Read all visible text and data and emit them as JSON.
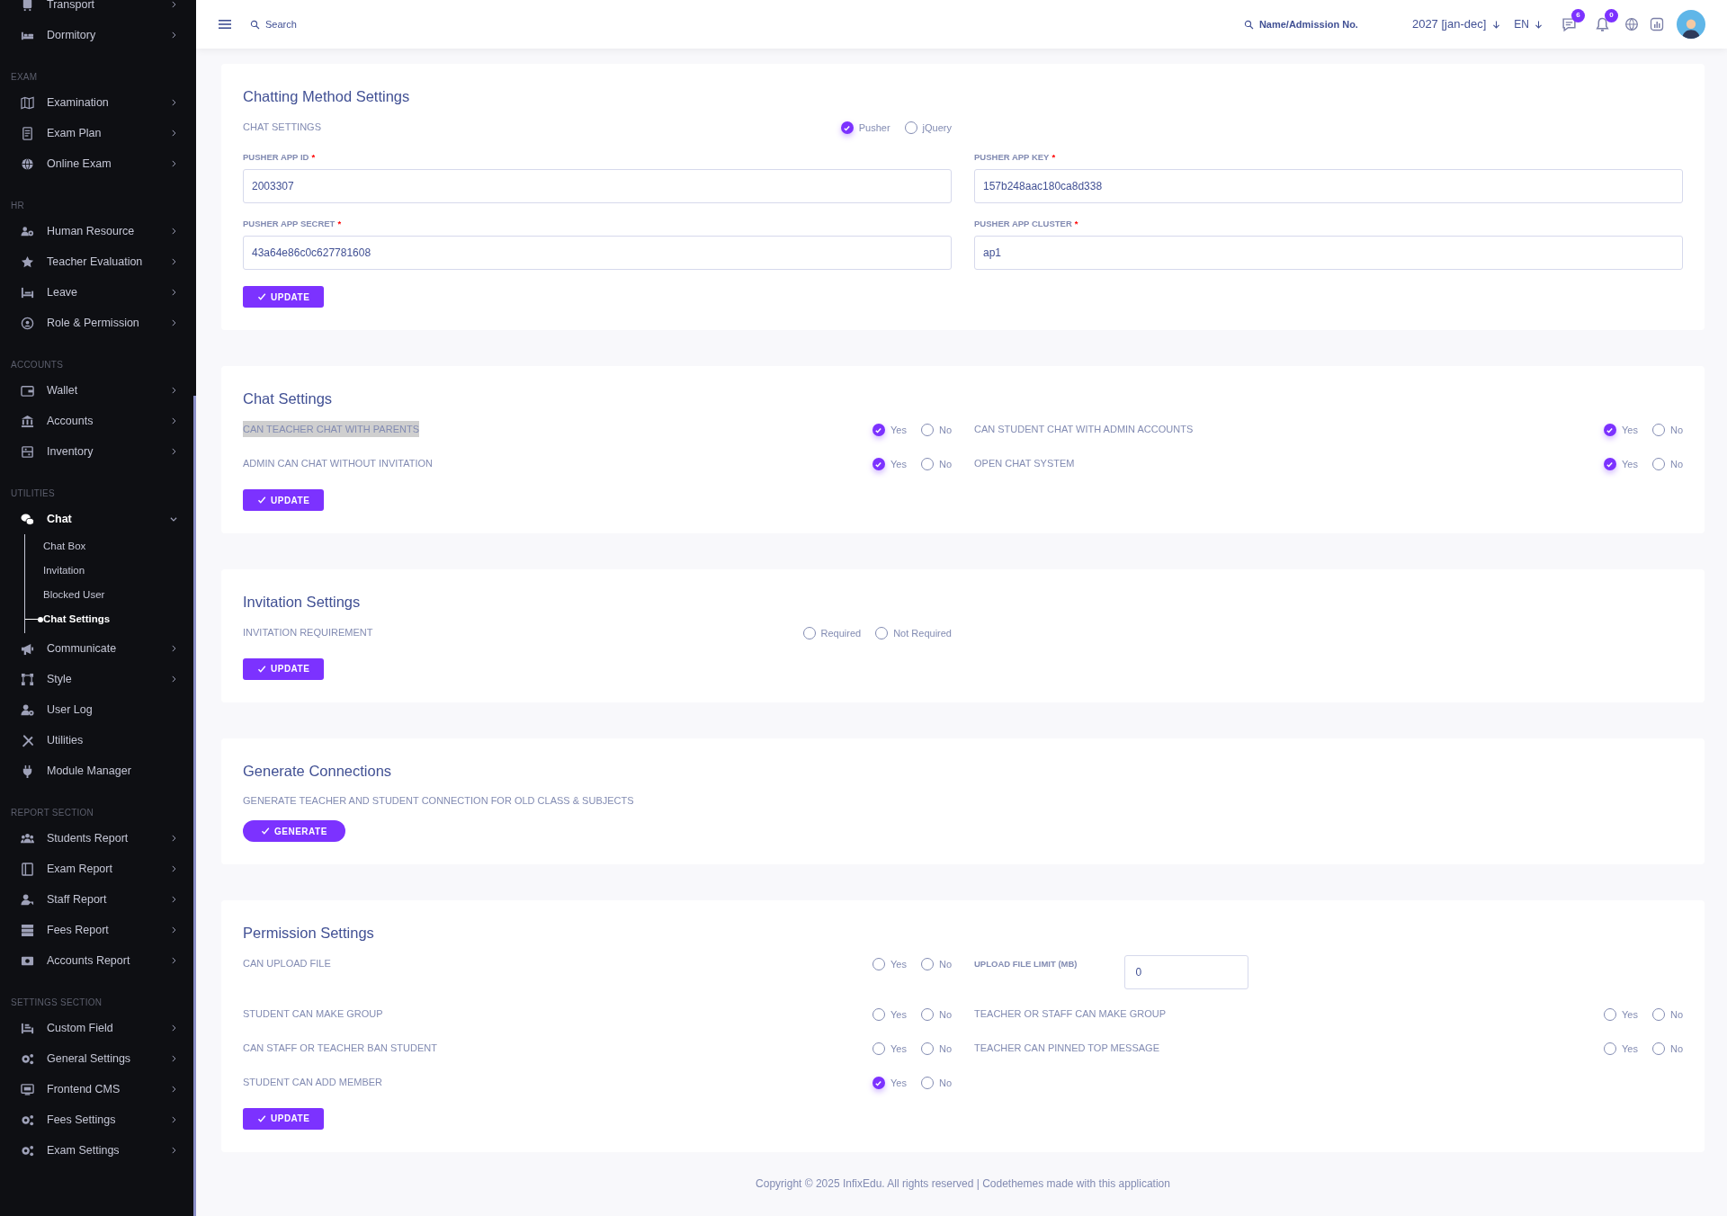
{
  "sidebar": {
    "items": [
      {
        "kind": "item",
        "label": "Transport",
        "expandable": true,
        "expanded": false
      },
      {
        "kind": "item",
        "label": "Dormitory",
        "expandable": true,
        "expanded": false
      },
      {
        "kind": "section",
        "label": "EXAM"
      },
      {
        "kind": "item",
        "label": "Examination",
        "expandable": true,
        "expanded": false
      },
      {
        "kind": "item",
        "label": "Exam Plan",
        "expandable": true,
        "expanded": false
      },
      {
        "kind": "item",
        "label": "Online Exam",
        "expandable": true,
        "expanded": false
      },
      {
        "kind": "section",
        "label": "HR"
      },
      {
        "kind": "item",
        "label": "Human Resource",
        "expandable": true,
        "expanded": false
      },
      {
        "kind": "item",
        "label": "Teacher Evaluation",
        "expandable": true,
        "expanded": false
      },
      {
        "kind": "item",
        "label": "Leave",
        "expandable": true,
        "expanded": false
      },
      {
        "kind": "item",
        "label": "Role & Permission",
        "expandable": true,
        "expanded": false
      },
      {
        "kind": "section",
        "label": "ACCOUNTS"
      },
      {
        "kind": "item",
        "label": "Wallet",
        "expandable": true,
        "expanded": false
      },
      {
        "kind": "item",
        "label": "Accounts",
        "expandable": true,
        "expanded": false
      },
      {
        "kind": "item",
        "label": "Inventory",
        "expandable": true,
        "expanded": false
      },
      {
        "kind": "section",
        "label": "UTILITIES"
      },
      {
        "kind": "item",
        "label": "Chat",
        "expandable": true,
        "expanded": true,
        "children": [
          {
            "label": "Chat Box",
            "selected": false
          },
          {
            "label": "Invitation",
            "selected": false
          },
          {
            "label": "Blocked User",
            "selected": false
          },
          {
            "label": "Chat Settings",
            "selected": true
          }
        ]
      },
      {
        "kind": "item",
        "label": "Communicate",
        "expandable": true,
        "expanded": false
      },
      {
        "kind": "item",
        "label": "Style",
        "expandable": true,
        "expanded": false
      },
      {
        "kind": "item",
        "label": "User Log",
        "expandable": false,
        "expanded": false
      },
      {
        "kind": "item",
        "label": "Utilities",
        "expandable": false,
        "expanded": false
      },
      {
        "kind": "item",
        "label": "Module Manager",
        "expandable": false,
        "expanded": false
      },
      {
        "kind": "section",
        "label": "REPORT SECTION"
      },
      {
        "kind": "item",
        "label": "Students Report",
        "expandable": true,
        "expanded": false
      },
      {
        "kind": "item",
        "label": "Exam Report",
        "expandable": true,
        "expanded": false
      },
      {
        "kind": "item",
        "label": "Staff Report",
        "expandable": true,
        "expanded": false
      },
      {
        "kind": "item",
        "label": "Fees Report",
        "expandable": true,
        "expanded": false
      },
      {
        "kind": "item",
        "label": "Accounts Report",
        "expandable": true,
        "expanded": false
      },
      {
        "kind": "section",
        "label": "SETTINGS SECTION"
      },
      {
        "kind": "item",
        "label": "Custom Field",
        "expandable": true,
        "expanded": false
      },
      {
        "kind": "item",
        "label": "General Settings",
        "expandable": true,
        "expanded": false
      },
      {
        "kind": "item",
        "label": "Frontend CMS",
        "expandable": true,
        "expanded": false
      },
      {
        "kind": "item",
        "label": "Fees Settings",
        "expandable": true,
        "expanded": false
      },
      {
        "kind": "item",
        "label": "Exam Settings",
        "expandable": true,
        "expanded": false
      }
    ]
  },
  "header": {
    "search": "Search",
    "student_search": "Name/Admission No.",
    "session": "2027 [jan-dec]",
    "language": "EN",
    "messages_badge": "6",
    "notifications_badge": "0"
  },
  "cards": [
    {
      "title": "Chatting Method Settings",
      "rows": [
        [
          {
            "kind": "radio",
            "label": "CHAT SETTINGS",
            "highlighted": false,
            "options": [
              {
                "label": "Pusher",
                "selected": true
              },
              {
                "label": "jQuery",
                "selected": false
              }
            ]
          }
        ],
        [
          {
            "kind": "input",
            "label": "PUSHER APP ID",
            "required_mark": "*",
            "value": "2003307"
          },
          {
            "kind": "input",
            "label": "PUSHER APP KEY",
            "required_mark": "*",
            "value": "157b248aac180ca8d338"
          }
        ],
        [
          {
            "kind": "input",
            "label": "PUSHER APP SECRET",
            "required_mark": "*",
            "value": "43a64e86c0c627781608"
          },
          {
            "kind": "input",
            "label": "PUSHER APP CLUSTER",
            "required_mark": "*",
            "value": "ap1"
          }
        ]
      ],
      "button": {
        "kind": "square",
        "label": "UPDATE"
      }
    },
    {
      "title": "Chat Settings",
      "rows": [
        [
          {
            "kind": "radio",
            "label": "CAN TEACHER CHAT WITH PARENTS",
            "highlighted": true,
            "options": [
              {
                "label": "Yes",
                "selected": true
              },
              {
                "label": "No",
                "selected": false
              }
            ]
          },
          {
            "kind": "radio",
            "label": "CAN STUDENT CHAT WITH ADMIN ACCOUNTS",
            "highlighted": false,
            "options": [
              {
                "label": "Yes",
                "selected": true
              },
              {
                "label": "No",
                "selected": false
              }
            ]
          }
        ],
        [
          {
            "kind": "radio",
            "label": "ADMIN CAN CHAT WITHOUT INVITATION",
            "highlighted": false,
            "options": [
              {
                "label": "Yes",
                "selected": true
              },
              {
                "label": "No",
                "selected": false
              }
            ]
          },
          {
            "kind": "radio",
            "label": "OPEN CHAT SYSTEM",
            "highlighted": false,
            "options": [
              {
                "label": "Yes",
                "selected": true
              },
              {
                "label": "No",
                "selected": false
              }
            ]
          }
        ]
      ],
      "button": {
        "kind": "square",
        "label": "UPDATE"
      }
    },
    {
      "title": "Invitation Settings",
      "rows": [
        [
          {
            "kind": "radio",
            "label": "INVITATION REQUIREMENT",
            "highlighted": false,
            "options": [
              {
                "label": "Required",
                "selected": false
              },
              {
                "label": "Not Required",
                "selected": false
              }
            ]
          }
        ]
      ],
      "button": {
        "kind": "square",
        "label": "UPDATE"
      }
    },
    {
      "title": "Generate Connections",
      "rows": [
        [
          {
            "kind": "note",
            "text": "GENERATE TEACHER AND STUDENT CONNECTION FOR OLD CLASS & SUBJECTS"
          }
        ]
      ],
      "button": {
        "kind": "pill",
        "label": "GENERATE"
      }
    },
    {
      "title": "Permission Settings",
      "rows": [
        [
          {
            "kind": "radio",
            "label": "CAN UPLOAD FILE",
            "highlighted": false,
            "options": [
              {
                "label": "Yes",
                "selected": false
              },
              {
                "label": "No",
                "selected": false
              }
            ]
          },
          {
            "kind": "inline_input",
            "label": "UPLOAD FILE LIMIT (MB)",
            "value": "0"
          }
        ],
        [
          {
            "kind": "radio",
            "label": "STUDENT CAN MAKE GROUP",
            "highlighted": false,
            "options": [
              {
                "label": "Yes",
                "selected": false
              },
              {
                "label": "No",
                "selected": false
              }
            ]
          },
          {
            "kind": "radio",
            "label": "TEACHER OR STAFF CAN MAKE GROUP",
            "highlighted": false,
            "options": [
              {
                "label": "Yes",
                "selected": false
              },
              {
                "label": "No",
                "selected": false
              }
            ]
          }
        ],
        [
          {
            "kind": "radio",
            "label": "CAN STAFF OR TEACHER BAN STUDENT",
            "highlighted": false,
            "options": [
              {
                "label": "Yes",
                "selected": false
              },
              {
                "label": "No",
                "selected": false
              }
            ]
          },
          {
            "kind": "radio",
            "label": "TEACHER CAN PINNED TOP MESSAGE",
            "highlighted": false,
            "options": [
              {
                "label": "Yes",
                "selected": false
              },
              {
                "label": "No",
                "selected": false
              }
            ]
          }
        ],
        [
          {
            "kind": "radio",
            "label": "STUDENT CAN ADD MEMBER",
            "highlighted": false,
            "options": [
              {
                "label": "Yes",
                "selected": true
              },
              {
                "label": "No",
                "selected": false
              }
            ]
          }
        ]
      ],
      "button": {
        "kind": "square",
        "label": "UPDATE"
      }
    }
  ],
  "footer": "Copyright © 2025 InfixEdu. All rights reserved | Codethemes made with this application"
}
